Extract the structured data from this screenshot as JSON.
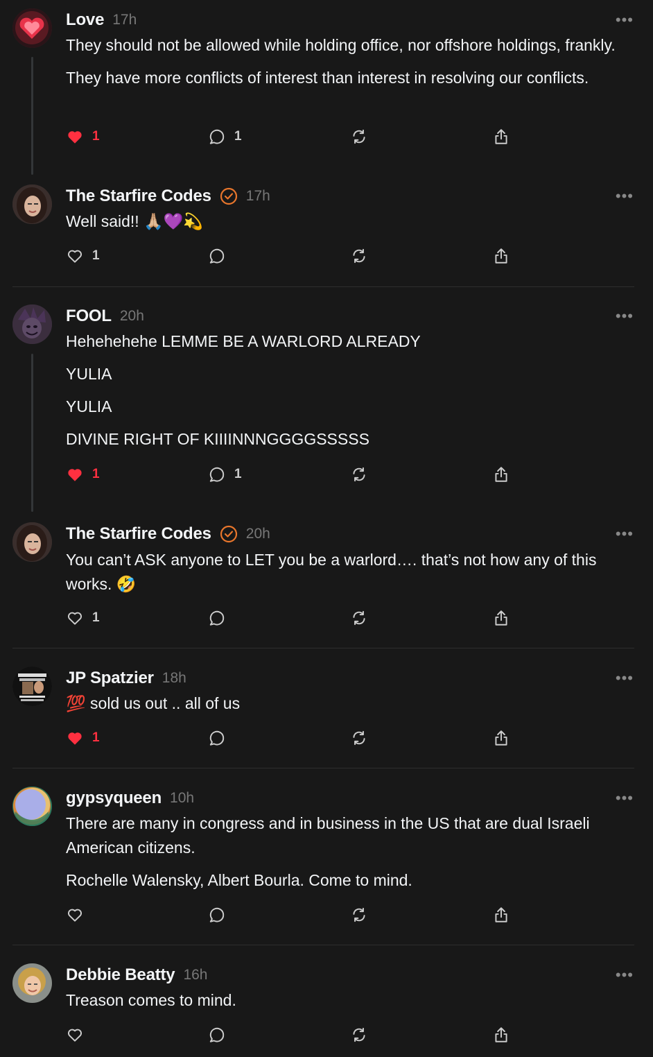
{
  "posts": [
    {
      "username": "Love",
      "time": "17h",
      "verified": false,
      "paragraphs": [
        "They should not be allowed while holding office, nor offshore holdings, frankly.",
        "They have more conflicts of interest than interest in resolving our conflicts."
      ],
      "likes": "1",
      "liked": true,
      "replies": "1",
      "avatar": "heart-avatar"
    },
    {
      "username": "The Starfire Codes",
      "time": "17h",
      "verified": true,
      "paragraphs": [
        "Well said!! 🙏🏼💜💫"
      ],
      "likes": "1",
      "liked": false,
      "replies": "",
      "avatar": "woman-avatar"
    },
    {
      "username": "FOOL",
      "time": "20h",
      "verified": false,
      "paragraphs": [
        "Hehehehehe LEMME BE A WARLORD ALREADY",
        "YULIA",
        "YULIA",
        "DIVINE RIGHT OF KIIIINNNGGGGSSSSS"
      ],
      "likes": "1",
      "liked": true,
      "replies": "1",
      "avatar": "jester-avatar"
    },
    {
      "username": "The Starfire Codes",
      "time": "20h",
      "verified": true,
      "paragraphs": [
        "You can’t ASK anyone to LET you be a warlord…. that’s not how any of this works. 🤣"
      ],
      "likes": "1",
      "liked": false,
      "replies": "",
      "avatar": "woman-avatar"
    },
    {
      "username": "JP Spatzier",
      "time": "18h",
      "verified": false,
      "paragraphs": [
        "💯 sold us out .. all of us"
      ],
      "likes": "1",
      "liked": true,
      "replies": "",
      "avatar": "meme-avatar"
    },
    {
      "username": "gypsyqueen",
      "time": "10h",
      "verified": false,
      "paragraphs": [
        "There are many in congress and in business in the US that are dual Israeli American citizens.",
        "Rochelle Walensky, Albert Bourla. Come to mind."
      ],
      "likes": "",
      "liked": false,
      "replies": "",
      "avatar": "moon-avatar"
    },
    {
      "username": "Debbie Beatty",
      "time": "16h",
      "verified": false,
      "paragraphs": [
        "Treason comes to mind."
      ],
      "likes": "",
      "liked": false,
      "replies": "",
      "avatar": "blonde-avatar"
    }
  ],
  "more_label": "•••",
  "colors": {
    "background": "#181818",
    "like": "#ff3040",
    "verified": "#e8762c",
    "muted": "#777777"
  }
}
